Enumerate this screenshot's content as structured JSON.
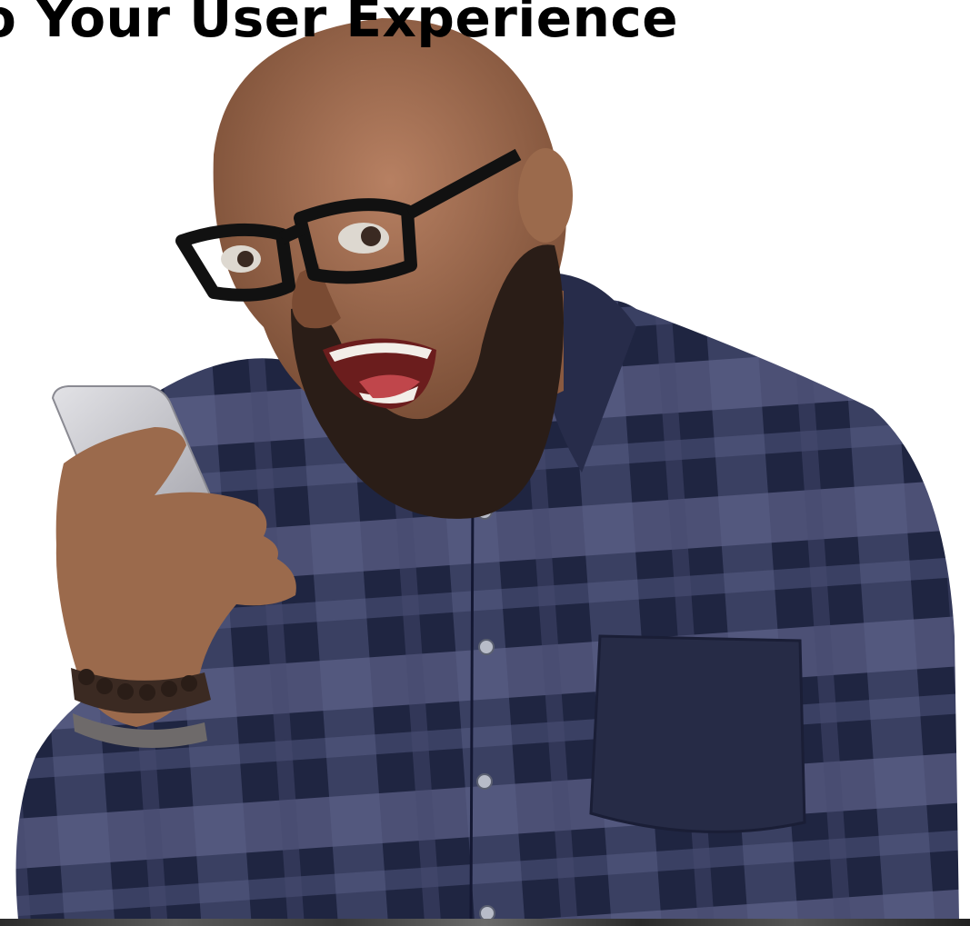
{
  "headline": {
    "text": "o Your User Experience"
  },
  "photo": {
    "subject": "man-shouting-at-phone",
    "colors": {
      "background": "#ffffff",
      "shirt_dark": "#1f2541",
      "shirt_plaid": "#5a5f86",
      "skin": "#9b6a4c",
      "beard": "#2a1d17",
      "glasses": "#111111",
      "phone": "#c9c9cf"
    }
  }
}
